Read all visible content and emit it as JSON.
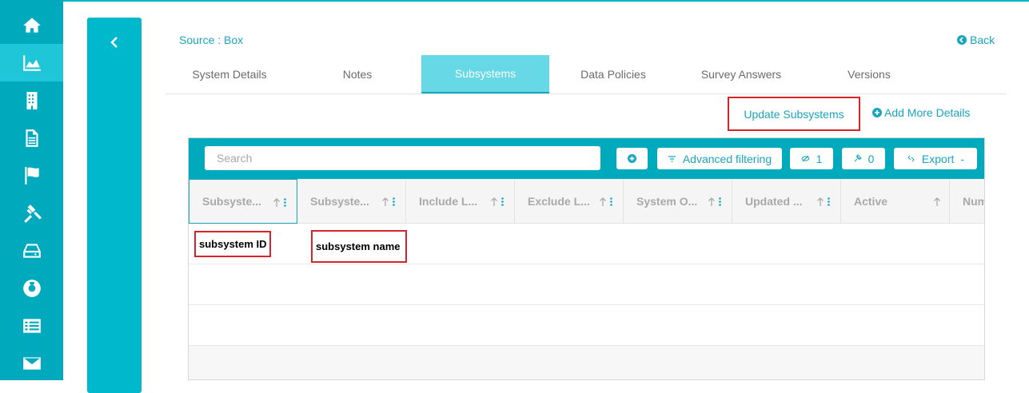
{
  "nav": {
    "items": [
      {
        "icon": "home-icon",
        "active": false
      },
      {
        "icon": "area-chart-icon",
        "active": true
      },
      {
        "icon": "building-icon",
        "active": false
      },
      {
        "icon": "document-icon",
        "active": false
      },
      {
        "icon": "flag-icon",
        "active": false
      },
      {
        "icon": "gavel-icon",
        "active": false
      },
      {
        "icon": "hdd-icon",
        "active": false
      },
      {
        "icon": "lifebuoy-icon",
        "active": false
      },
      {
        "icon": "list-icon",
        "active": false
      },
      {
        "icon": "envelope-icon",
        "active": false
      }
    ]
  },
  "header": {
    "source": "Source : Box",
    "back": "Back"
  },
  "tabs": [
    {
      "label": "System Details",
      "active": false
    },
    {
      "label": "Notes",
      "active": false
    },
    {
      "label": "Subsystems",
      "active": true
    },
    {
      "label": "Data Policies",
      "active": false
    },
    {
      "label": "Survey Answers",
      "active": false
    },
    {
      "label": "Versions",
      "active": false
    }
  ],
  "actions": {
    "update": "Update Subsystems",
    "add_more": "Add More Details"
  },
  "toolbar": {
    "search_placeholder": "Search",
    "advanced_filtering": "Advanced filtering",
    "hidden_count": "1",
    "pinned_count": "0",
    "export": "Export",
    "export_suffix": "-"
  },
  "table": {
    "columns": [
      "Subsyste...",
      "Subsyste...",
      "Include L...",
      "Exclude L...",
      "System O...",
      "Updated ...",
      "Active",
      "Num"
    ],
    "rows": [
      {
        "subsystem_id": "subsystem ID",
        "subsystem_name": "subsystem name"
      }
    ]
  },
  "colors": {
    "brand": "#00a9bc",
    "active_tab": "#66d8e6",
    "link": "#1aa5bd",
    "highlight": "#d8222c"
  }
}
